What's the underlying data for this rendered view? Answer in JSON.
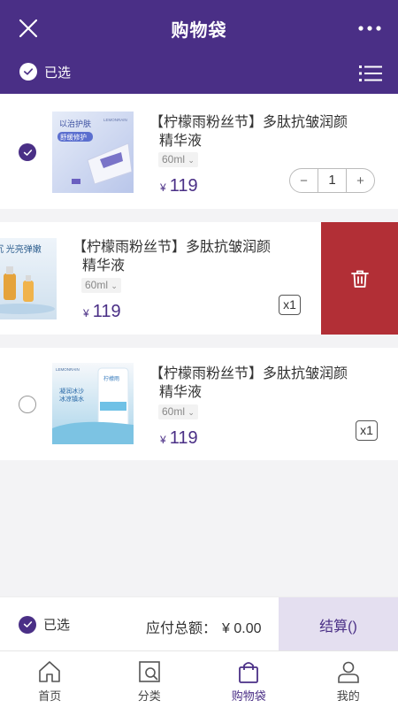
{
  "header": {
    "title": "购物袋",
    "selected_label": "已选"
  },
  "items": [
    {
      "name_line1": "【柠檬雨粉丝节】多肽抗皱润颜",
      "name_line2": "精华液",
      "spec": "60ml",
      "currency": "¥",
      "price": "119",
      "quantity": "1",
      "checked": true,
      "thumb_text1": "以治护肤",
      "thumb_text2": "舒缓修护",
      "thumb_brand": "LEMONRAIN"
    },
    {
      "name_line1": "【柠檬雨粉丝节】多肽抗皱润颜",
      "name_line2": "精华液",
      "spec": "60ml",
      "currency": "¥",
      "price": "119",
      "quantity_badge": "x1",
      "thumb_text1": "阳明沉 光亮弹嫩"
    },
    {
      "name_line1": "【柠檬雨粉丝节】多肽抗皱润颜",
      "name_line2": "精华液",
      "spec": "60ml",
      "currency": "¥",
      "price": "119",
      "quantity_badge": "x1",
      "checked": false,
      "thumb_brand": "LEMONRAIN",
      "thumb_text1": "凝润冰沙",
      "thumb_text2": "冰凉镇水",
      "thumb_text3": "柠檬雨"
    }
  ],
  "footer": {
    "selected_label": "已选",
    "total_label": "应付总额：",
    "total_value": "¥ 0.00",
    "checkout_label": "结算()"
  },
  "tabbar": [
    {
      "label": "首页",
      "icon": "home-icon"
    },
    {
      "label": "分类",
      "icon": "category-icon"
    },
    {
      "label": "购物袋",
      "icon": "bag-icon",
      "active": true
    },
    {
      "label": "我的",
      "icon": "user-icon"
    }
  ],
  "colors": {
    "primary": "#4a2f86",
    "delete": "#b22f36",
    "checkout_bg": "#e4dff0"
  }
}
